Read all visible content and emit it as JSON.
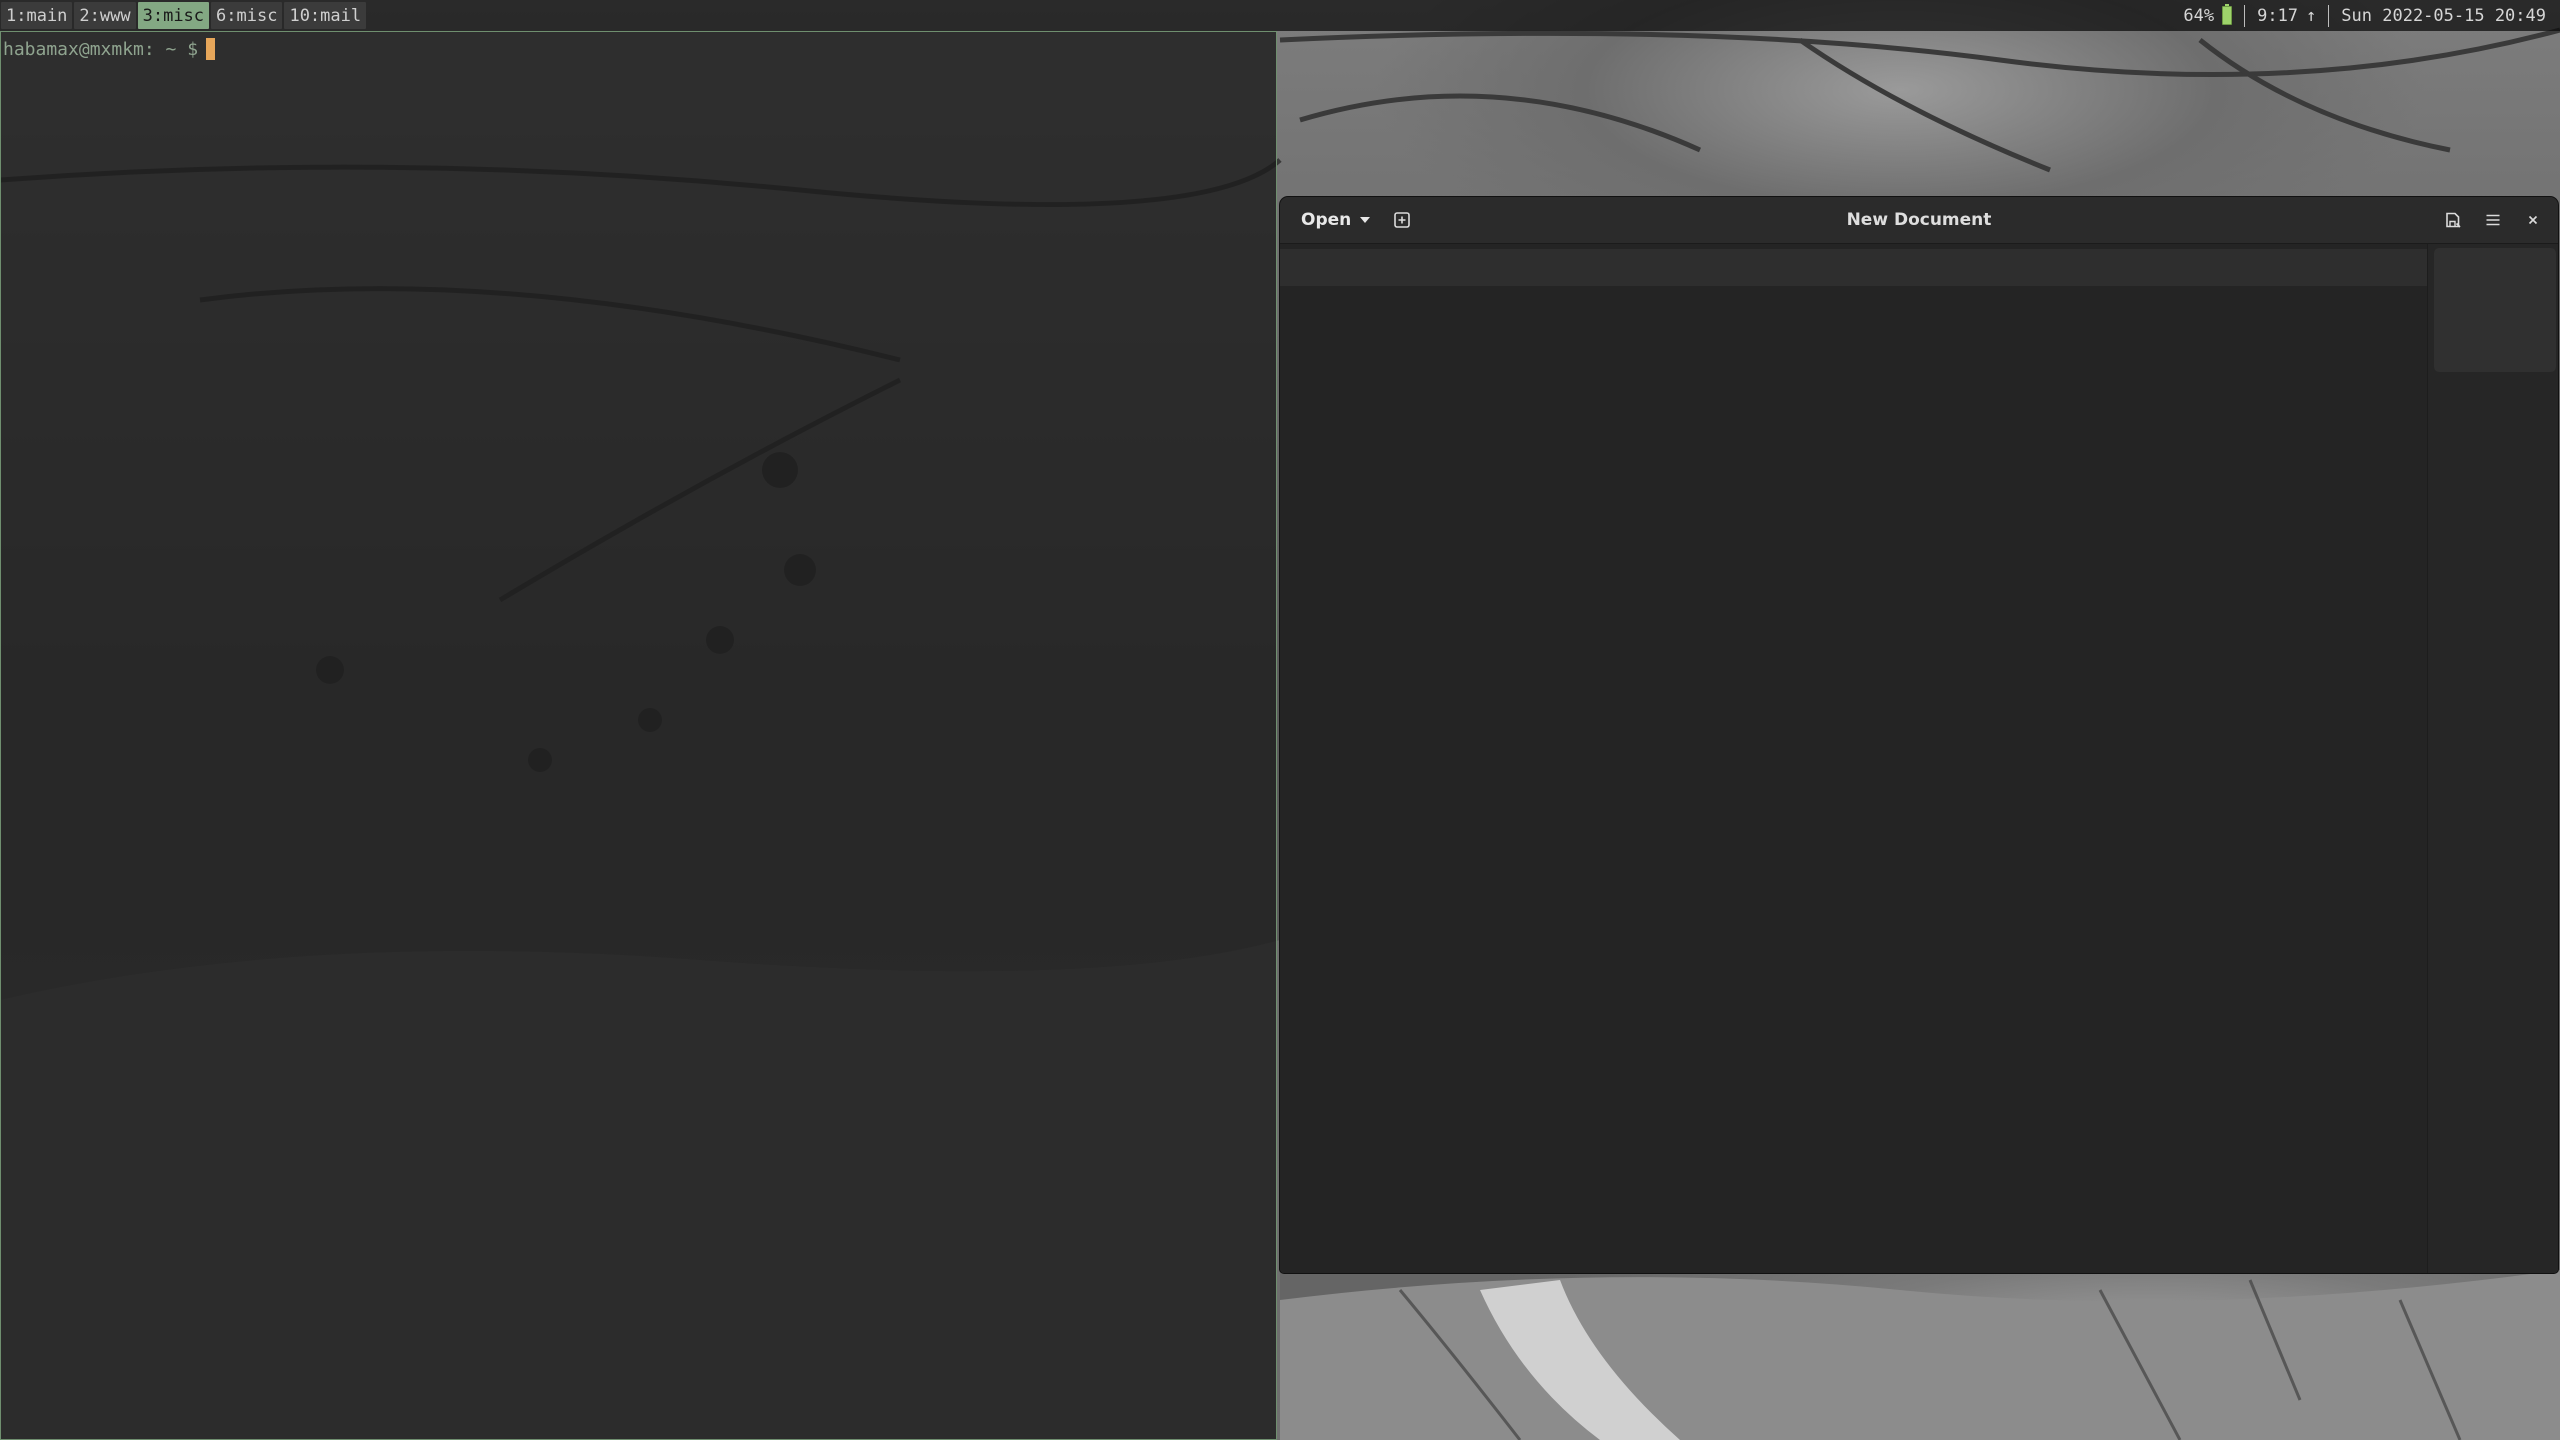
{
  "statusbar": {
    "workspaces": [
      {
        "label": "1:main",
        "active": false
      },
      {
        "label": "2:www",
        "active": false
      },
      {
        "label": "3:misc",
        "active": true
      },
      {
        "label": "6:misc",
        "active": false
      },
      {
        "label": "10:mail",
        "active": false
      }
    ],
    "battery": "64%",
    "battery_time": "9:17",
    "charge_arrow": "↑",
    "datetime": "Sun 2022-05-15 20:49",
    "colors": {
      "active_ws": "#83a883",
      "battery": "#9ed36b"
    }
  },
  "terminal": {
    "prompt": "habamax@mxmkm: ~ $",
    "colors": {
      "prompt": "#8fa48f",
      "cursor": "#e6a65a",
      "border": "#6f8f6f"
    }
  },
  "editor": {
    "open_label": "Open",
    "title": "New Document",
    "icons": {
      "new_tab": "new-tab-icon",
      "save": "save-icon",
      "menu": "hamburger-menu-icon",
      "close": "close-icon"
    }
  }
}
